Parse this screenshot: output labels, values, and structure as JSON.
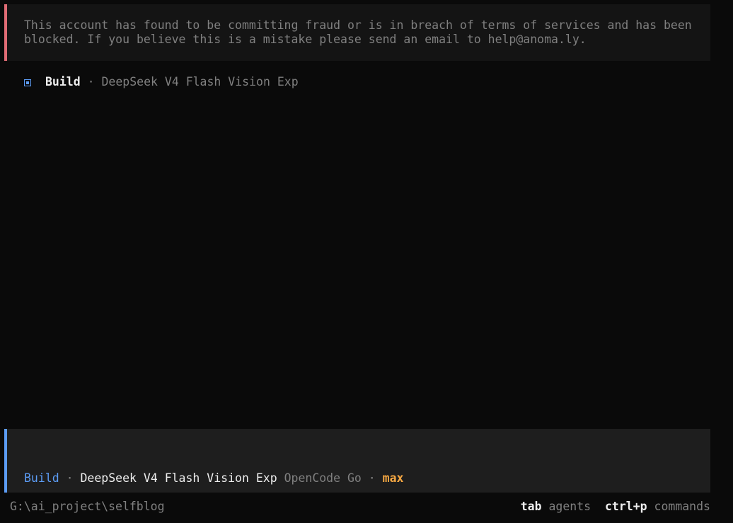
{
  "colors": {
    "error_accent": "#e06c75",
    "agent_accent": "#5c9cf5",
    "variant_accent": "#f5a742"
  },
  "error": {
    "line1": "This account has found to be committing fraud or is in breach of terms of services and has been",
    "line2": "blocked. If you believe this is a mistake please send an email to help@anoma.ly."
  },
  "status": {
    "icon": "square-icon",
    "agent": "Build",
    "separator": " · ",
    "model": "DeepSeek V4 Flash Vision Exp"
  },
  "prompt": {
    "value": "",
    "agent": "Build",
    "separator1": " · ",
    "model": "DeepSeek V4 Flash Vision Exp",
    "provider": "OpenCode Go",
    "separator2": " · ",
    "variant": "max"
  },
  "footer": {
    "path": "G:\\ai_project\\selfblog",
    "tab_key": "tab",
    "tab_label": "agents",
    "cmd_key": "ctrl+p",
    "cmd_label": "commands"
  }
}
